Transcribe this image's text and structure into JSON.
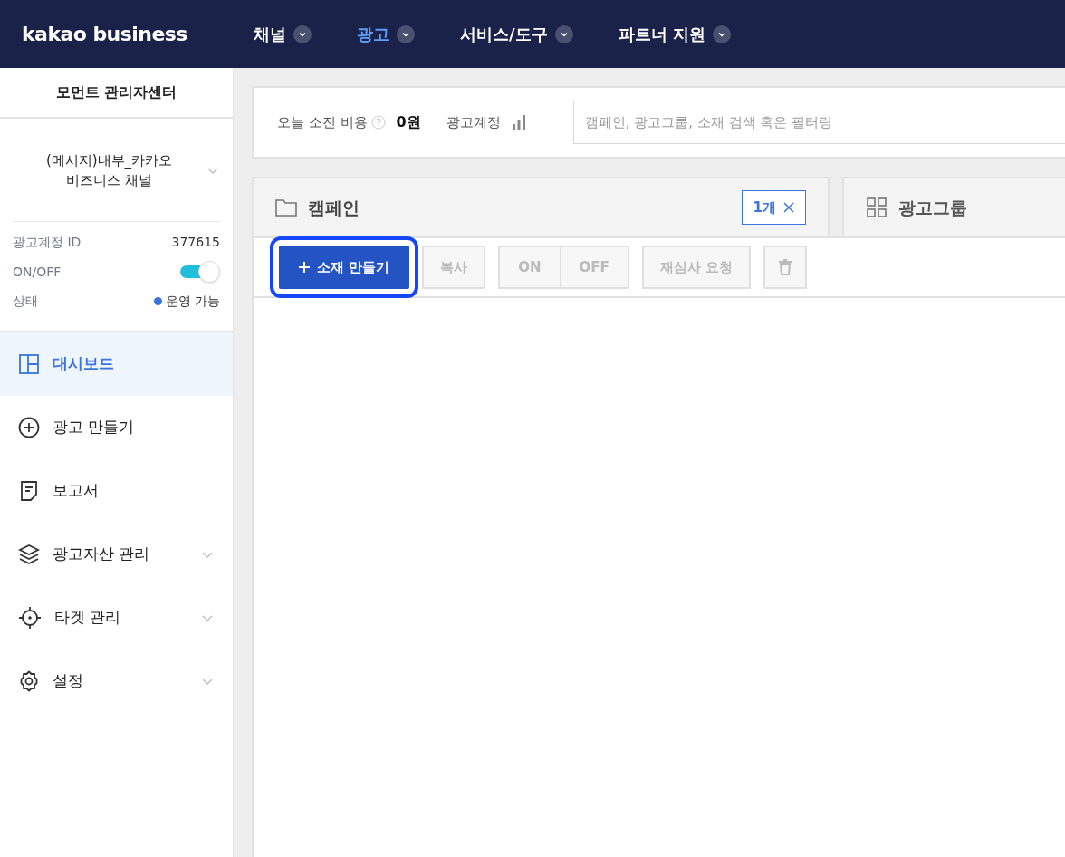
{
  "header": {
    "logo": "kakao business",
    "nav": [
      {
        "label": "채널",
        "selected": false
      },
      {
        "label": "광고",
        "selected": true
      },
      {
        "label": "서비스/도구",
        "selected": false
      },
      {
        "label": "파트너 지원",
        "selected": false
      }
    ]
  },
  "sidebar": {
    "title": "모먼트 관리자센터",
    "channel": "(메시지)내부_카카오비즈니스 채널",
    "account": {
      "id_label": "광고계정 ID",
      "id_value": "377615",
      "onoff_label": "ON/OFF",
      "on": true,
      "status": {
        "label": "상태",
        "value": "운영 가능",
        "color": "#3b73e0"
      }
    },
    "items": [
      {
        "kind": "dashboard",
        "label": "대시보드",
        "selected": true,
        "expandable": false
      },
      {
        "kind": "create",
        "label": "광고 만들기",
        "selected": false,
        "expandable": false
      },
      {
        "kind": "report",
        "label": "보고서",
        "selected": false,
        "expandable": false
      },
      {
        "kind": "assets",
        "label": "광고자산 관리",
        "selected": false,
        "expandable": true
      },
      {
        "kind": "target",
        "label": "타겟 관리",
        "selected": false,
        "expandable": true
      },
      {
        "kind": "settings",
        "label": "설정",
        "selected": false,
        "expandable": true
      }
    ]
  },
  "summary": {
    "spend_label": "오늘 소진 비용",
    "spend_value": "0원",
    "account_label": "광고계정",
    "search": {
      "placeholder": "캠페인, 광고그룹, 소재 검색 혹은 필터링"
    }
  },
  "tabs": [
    {
      "kind": "campaign",
      "label": "캠페인",
      "selected": true,
      "badge": "1개"
    },
    {
      "kind": "adgroup",
      "label": "광고그룹",
      "selected": false
    }
  ],
  "toolbar": [
    {
      "kind": "primary",
      "label": "소재 만들기",
      "disabled": false,
      "highlighted": true
    },
    {
      "kind": "plain",
      "label": "복사",
      "disabled": true,
      "highlighted": false
    },
    {
      "kind": "pair",
      "labels": [
        "ON",
        "OFF"
      ],
      "disabled": true,
      "highlighted": false
    },
    {
      "kind": "plain",
      "label": "재심사 요청",
      "disabled": true,
      "highlighted": false
    },
    {
      "kind": "trash",
      "disabled": true,
      "highlighted": false
    }
  ]
}
